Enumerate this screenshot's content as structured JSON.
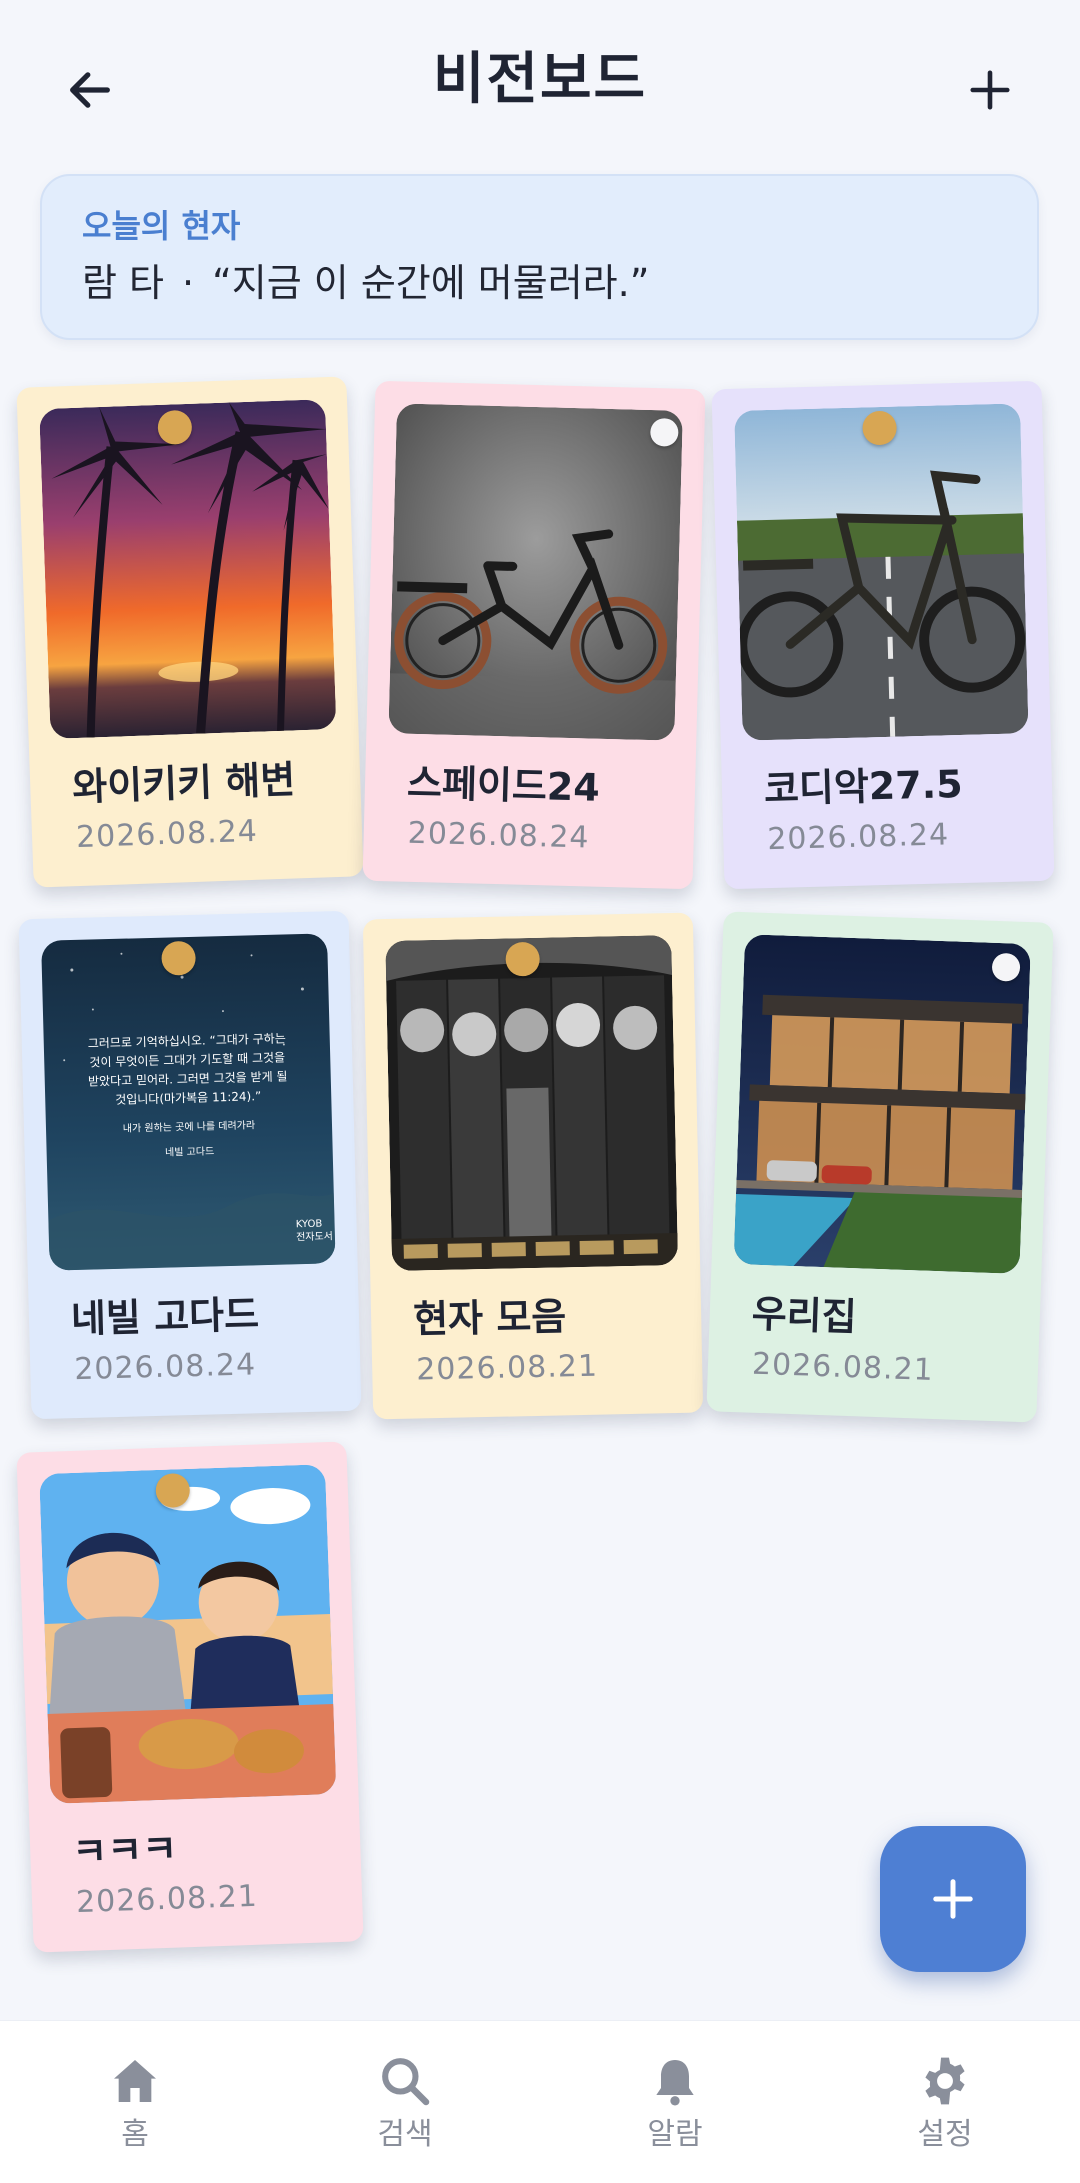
{
  "header": {
    "title": "비전보드"
  },
  "quote": {
    "label": "오늘의 현자",
    "author": "람 타",
    "separator": "·",
    "text": "“지금 이 순간에 머물러라.”"
  },
  "cards": [
    {
      "name": "와이키키 해변",
      "date": "2026.08.24",
      "color": "#fdefcf"
    },
    {
      "name": "스페이드24",
      "date": "2026.08.24",
      "color": "#fddde6"
    },
    {
      "name": "코디악27.5",
      "date": "2026.08.24",
      "color": "#e6e1fb"
    },
    {
      "name": "네빌 고다드",
      "date": "2026.08.24",
      "color": "#dfeafc",
      "photo_text": [
        "그러므로 기억하십시오. “그대가 구하는",
        "것이 무엇이든 그대가 기도할 때 그것을",
        "받았다고 믿어라. 그러면 그것을 받게 될",
        "것입니다(마가복음 11:24).”",
        "내가 원하는 곳에 나를 데려가라",
        "네빌 고다드",
        "KYOB",
        "전자도서"
      ]
    },
    {
      "name": "현자 모음",
      "date": "2026.08.21",
      "color": "#fdefcf"
    },
    {
      "name": "우리집",
      "date": "2026.08.21",
      "color": "#ddf1e3"
    },
    {
      "name": "ㅋㅋㅋ",
      "date": "2026.08.21",
      "color": "#fddde6"
    }
  ],
  "nav": [
    {
      "label": "홈",
      "icon": "home-icon"
    },
    {
      "label": "검색",
      "icon": "search-icon"
    },
    {
      "label": "알람",
      "icon": "bell-icon"
    },
    {
      "label": "설정",
      "icon": "gear-icon"
    }
  ],
  "colors": {
    "accent": "#4e7fd3",
    "pin": "#d8a653",
    "background": "#f4f6fb"
  }
}
